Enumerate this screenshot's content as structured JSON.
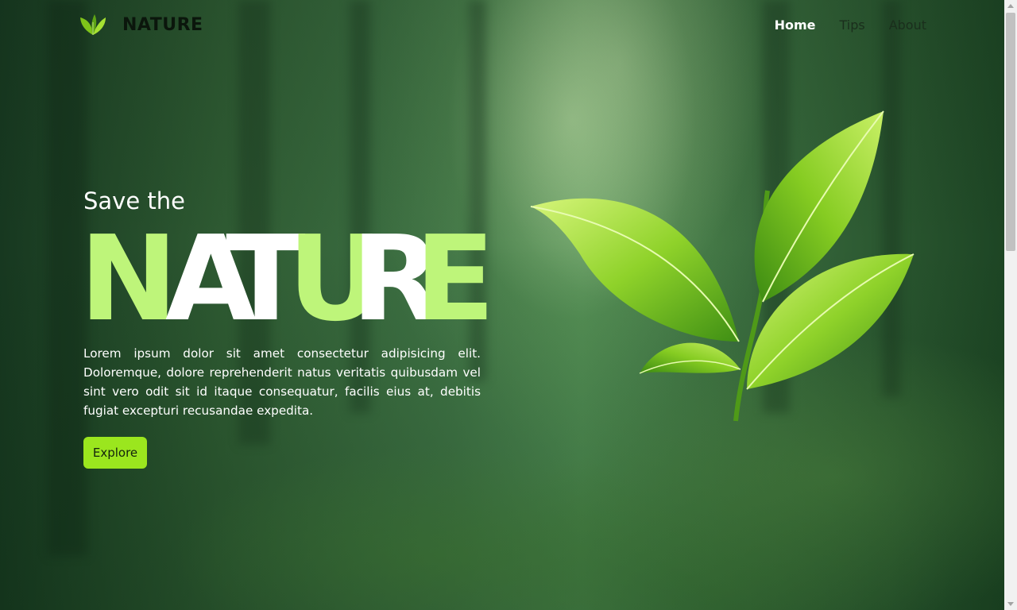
{
  "header": {
    "logo_text": "NATURE",
    "nav": [
      {
        "label": "Home",
        "active": true
      },
      {
        "label": "Tips",
        "active": false
      },
      {
        "label": "About",
        "active": false
      }
    ]
  },
  "hero": {
    "subtitle": "Save the",
    "big_word": "NATURE",
    "big_word_letters": [
      "N",
      "A",
      "T",
      "U",
      "R",
      "E"
    ],
    "paragraph": "Lorem ipsum dolor sit amet consectetur adipisicing elit. Doloremque, dolore reprehenderit natus veritatis quibusdam vel sint vero odit sit id itaque consequatur, facilis eius at, debitis fugiat excepturi recusandae expedita.",
    "button_label": "Explore"
  },
  "colors": {
    "accent_green": "#9be61e",
    "light_green": "#bef57a",
    "white": "#ffffff",
    "forest_dark": "#173820"
  },
  "icons": {
    "logo": "leaf-logo-icon",
    "hero_image": "green-leaves-icon"
  }
}
